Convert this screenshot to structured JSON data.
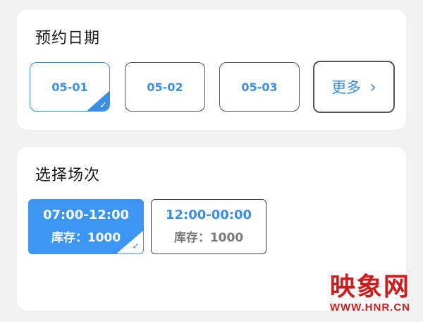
{
  "date_section": {
    "title": "预约日期",
    "dates": [
      {
        "label": "05-01",
        "selected": true
      },
      {
        "label": "05-02",
        "selected": false
      },
      {
        "label": "05-03",
        "selected": false
      }
    ],
    "more_label": "更多",
    "more_icon": "chevron-right-icon"
  },
  "session_section": {
    "title": "选择场次",
    "slots": [
      {
        "time": "07:00-12:00",
        "stock": "库存：1000",
        "selected": true
      },
      {
        "time": "12:00-00:00",
        "stock": "库存：1000",
        "selected": false
      }
    ]
  },
  "watermark": {
    "logo": "映象网",
    "url": "WWW.HNR.CN",
    "color": "#d21a1a"
  },
  "colors": {
    "accent": "#3a8ee6",
    "selected_fill": "#3d95f3",
    "background": "#f2f2f2"
  }
}
